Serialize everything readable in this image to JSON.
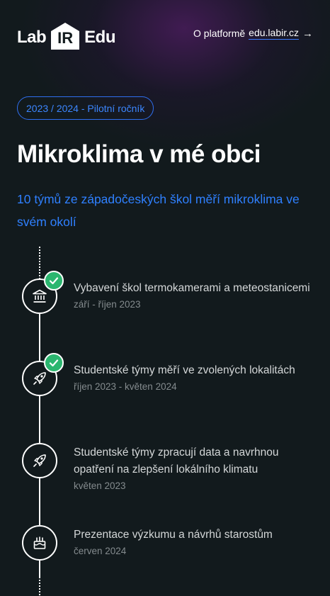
{
  "header": {
    "logo": {
      "left": "Lab",
      "mark": "IR",
      "right": "Edu"
    },
    "nav": {
      "prefix": "O platformě",
      "link": "edu.labir.cz",
      "arrow": "→"
    }
  },
  "badge": "2023 / 2024 - Pilotní ročník",
  "title": "Mikroklima v mé obci",
  "subtitle": "10 týmů ze západočeských škol měří mikroklima ve svém okolí",
  "colors": {
    "accent": "#2f80ff",
    "check": "#2bb66f",
    "background": "#121a1d"
  },
  "timeline": [
    {
      "icon": "bank-icon",
      "completed": true,
      "title": "Vybavení škol termokamerami a meteostanicemi",
      "date": "září - říjen 2023"
    },
    {
      "icon": "rocket-icon",
      "completed": true,
      "title": "Studentské týmy měří ve zvolených lokalitách",
      "date": "říjen 2023 - květen 2024"
    },
    {
      "icon": "rocket-icon",
      "completed": false,
      "title": "Studentské týmy zpracují data a navrhnou opatření na zlepšení lokálního klimatu",
      "date": "květen 2023"
    },
    {
      "icon": "cake-icon",
      "completed": false,
      "title": "Prezentace výzkumu a návrhů starostům",
      "date": "červen 2024"
    }
  ]
}
